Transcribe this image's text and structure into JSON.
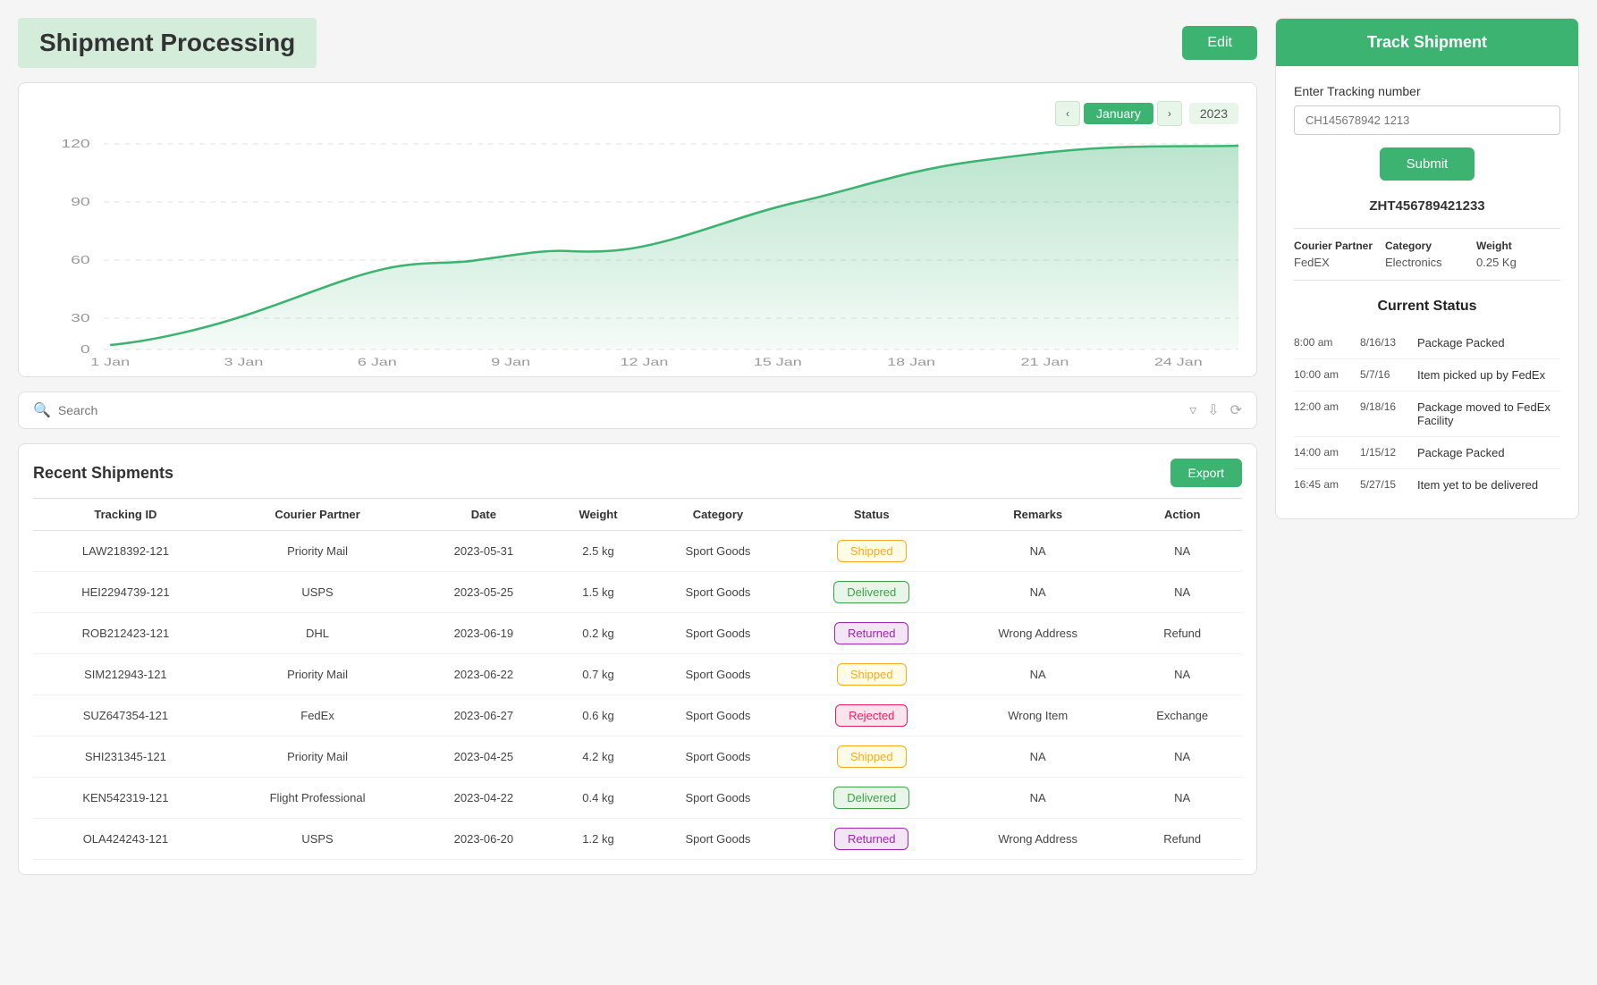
{
  "header": {
    "title": "Shipment Processing",
    "edit_btn": "Edit"
  },
  "chart": {
    "month": "January",
    "year": "2023",
    "y_labels": [
      "120",
      "90",
      "60",
      "30",
      "0"
    ],
    "x_labels": [
      "1 Jan",
      "3 Jan",
      "6 Jan",
      "9 Jan",
      "12 Jan",
      "15 Jan",
      "18 Jan",
      "21 Jan",
      "24 Jan"
    ]
  },
  "search": {
    "placeholder": "Search"
  },
  "table": {
    "title": "Recent Shipments",
    "export_btn": "Export",
    "columns": [
      "Tracking ID",
      "Courier Partner",
      "Date",
      "Weight",
      "Category",
      "Status",
      "Remarks",
      "Action"
    ],
    "rows": [
      {
        "id": "LAW218392-121",
        "courier": "Priority Mail",
        "date": "2023-05-31",
        "weight": "2.5 kg",
        "category": "Sport Goods",
        "status": "Shipped",
        "status_class": "status-shipped",
        "remarks": "NA",
        "action": "NA"
      },
      {
        "id": "HEI2294739-121",
        "courier": "USPS",
        "date": "2023-05-25",
        "weight": "1.5 kg",
        "category": "Sport Goods",
        "status": "Delivered",
        "status_class": "status-delivered",
        "remarks": "NA",
        "action": "NA"
      },
      {
        "id": "ROB212423-121",
        "courier": "DHL",
        "date": "2023-06-19",
        "weight": "0.2 kg",
        "category": "Sport Goods",
        "status": "Returned",
        "status_class": "status-returned",
        "remarks": "Wrong Address",
        "action": "Refund"
      },
      {
        "id": "SIM212943-121",
        "courier": "Priority Mail",
        "date": "2023-06-22",
        "weight": "0.7 kg",
        "category": "Sport Goods",
        "status": "Shipped",
        "status_class": "status-shipped",
        "remarks": "NA",
        "action": "NA"
      },
      {
        "id": "SUZ647354-121",
        "courier": "FedEx",
        "date": "2023-06-27",
        "weight": "0.6 kg",
        "category": "Sport Goods",
        "status": "Rejected",
        "status_class": "status-rejected",
        "remarks": "Wrong Item",
        "action": "Exchange"
      },
      {
        "id": "SHI231345-121",
        "courier": "Priority Mail",
        "date": "2023-04-25",
        "weight": "4.2 kg",
        "category": "Sport Goods",
        "status": "Shipped",
        "status_class": "status-shipped",
        "remarks": "NA",
        "action": "NA"
      },
      {
        "id": "KEN542319-121",
        "courier": "Flight Professional",
        "date": "2023-04-22",
        "weight": "0.4 kg",
        "category": "Sport Goods",
        "status": "Delivered",
        "status_class": "status-delivered",
        "remarks": "NA",
        "action": "NA"
      },
      {
        "id": "OLA424243-121",
        "courier": "USPS",
        "date": "2023-06-20",
        "weight": "1.2 kg",
        "category": "Sport Goods",
        "status": "Returned",
        "status_class": "status-returned",
        "remarks": "Wrong Address",
        "action": "Refund"
      }
    ]
  },
  "track_shipment": {
    "title": "Track Shipment",
    "input_label": "Enter Tracking number",
    "input_placeholder": "CH145678942 1213",
    "submit_btn": "Submit",
    "tracking_number": "ZHT456789421233",
    "courier_partner_label": "Courier Partner",
    "courier_partner_value": "FedEX",
    "category_label": "Category",
    "category_value": "Electronics",
    "weight_label": "Weight",
    "weight_value": "0.25 Kg",
    "current_status_title": "Current Status",
    "timeline": [
      {
        "time": "8:00 am",
        "date": "8/16/13",
        "desc": "Package Packed"
      },
      {
        "time": "10:00 am",
        "date": "5/7/16",
        "desc": "Item picked up by FedEx"
      },
      {
        "time": "12:00 am",
        "date": "9/18/16",
        "desc": "Package moved to FedEx Facility"
      },
      {
        "time": "14:00 am",
        "date": "1/15/12",
        "desc": "Package Packed"
      },
      {
        "time": "16:45 am",
        "date": "5/27/15",
        "desc": "Item yet to be delivered"
      }
    ]
  }
}
